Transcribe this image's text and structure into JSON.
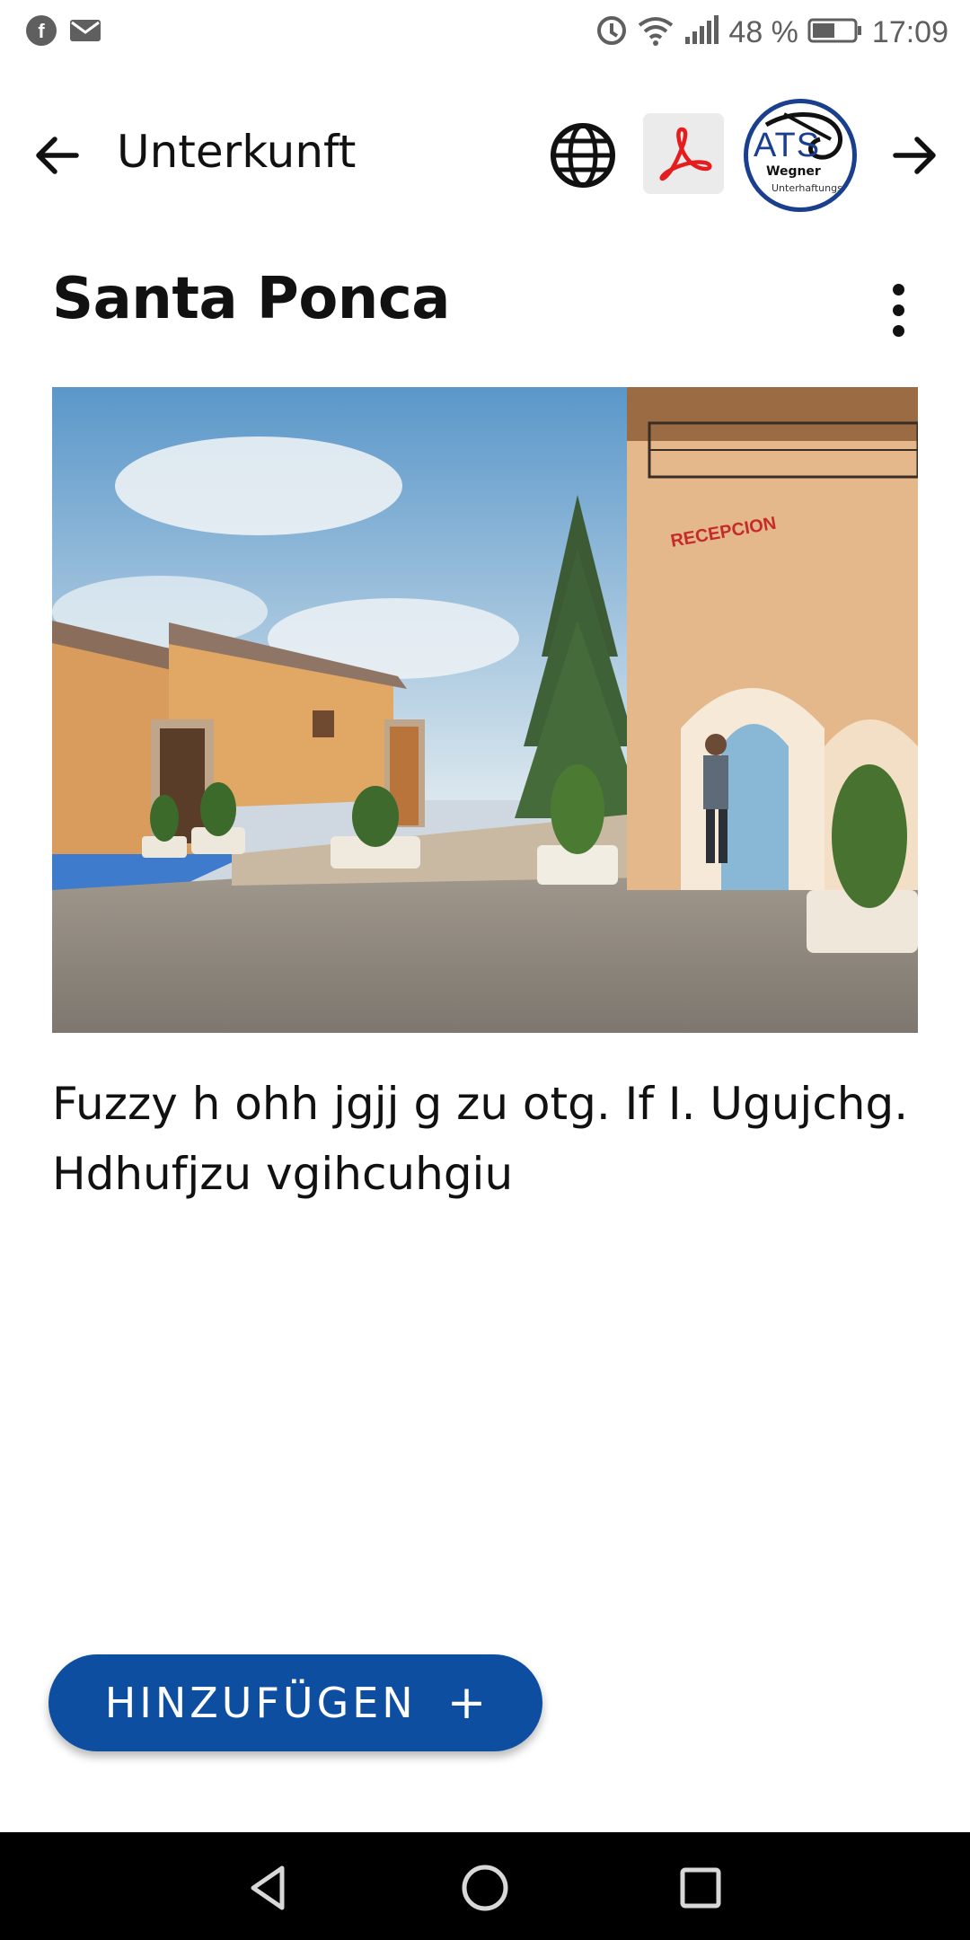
{
  "status_bar": {
    "battery_percent": "48 %",
    "time": "17:09",
    "left_icons": [
      "facebook-notification-icon",
      "mail-notification-icon"
    ],
    "right_icons": [
      "data-saver-icon",
      "wifi-icon",
      "signal-icon",
      "battery-icon"
    ]
  },
  "app_bar": {
    "title": "Unterkunft",
    "logo_text": "ATS",
    "logo_name": "Wegner",
    "logo_sub": "Unterhaftungsgesch"
  },
  "accommodation": {
    "name": "Santa Ponca",
    "photo_sign": "RECEPCION",
    "description": "Fuzzy h ohh jgjj g zu otg. If I. Ugujchg. Hdhufjzu vgihcuhgiu"
  },
  "actions": {
    "add_label": "HINZUFÜGEN",
    "add_symbol": "+"
  },
  "colors": {
    "accent": "#0d4ea1",
    "pdf_red": "#e41e1e",
    "logo_blue": "#1b3f8f",
    "nav_bar": "#000000"
  }
}
